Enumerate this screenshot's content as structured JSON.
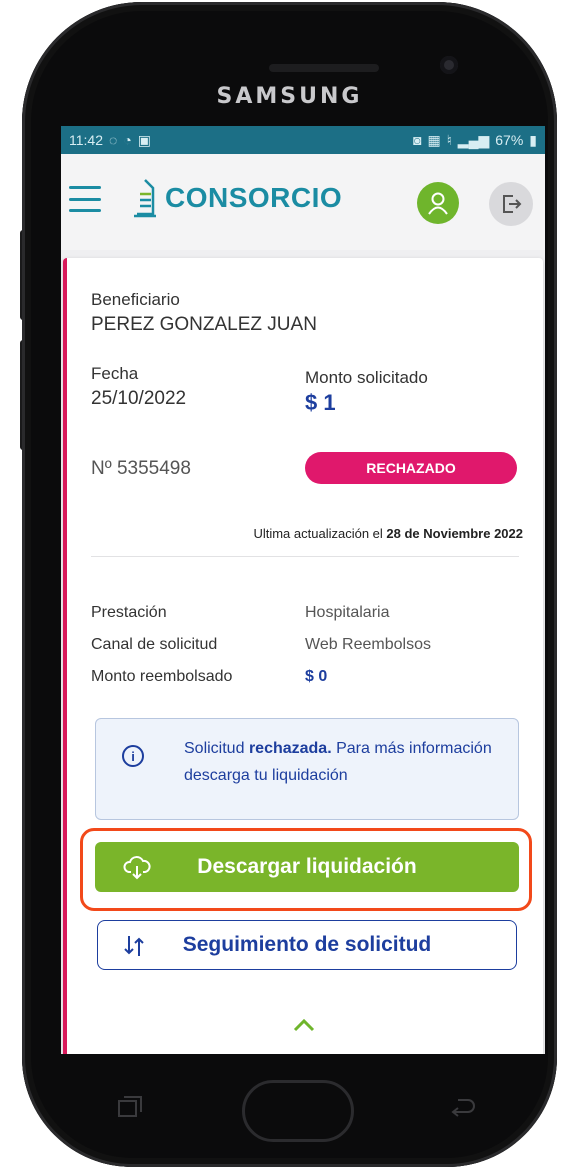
{
  "device": {
    "brand": "SAMSUNG"
  },
  "statusbar": {
    "time": "11:42",
    "battery": "67%"
  },
  "app": {
    "logo_text": "CONSORCIO"
  },
  "card": {
    "beneficiario_label": "Beneficiario",
    "beneficiario": "PEREZ GONZALEZ JUAN",
    "fecha_label": "Fecha",
    "fecha": "25/10/2022",
    "monto_solicitado_label": "Monto solicitado",
    "monto_solicitado": "$ 1",
    "numero": "Nº 5355498",
    "status": "RECHAZADO",
    "update_prefix": "Ultima actualización el",
    "update_date": "28 de Noviembre 2022",
    "prestacion_label": "Prestación",
    "prestacion": "Hospitalaria",
    "canal_label": "Canal de solicitud",
    "canal": "Web Reembolsos",
    "monto_reembolsado_label": "Monto reembolsado",
    "monto_reembolsado": "$ 0",
    "info_prefix": "Solicitud",
    "info_bold": "rechazada.",
    "info_suffix": "Para más información descarga tu liquidación",
    "download_label": "Descargar liquidación",
    "tracking_label": "Seguimiento de solicitud"
  },
  "colors": {
    "accent_blue": "#1d3e9e",
    "accent_green": "#7ab52a",
    "status_pink": "#e0186c",
    "highlight": "#f2491a"
  }
}
